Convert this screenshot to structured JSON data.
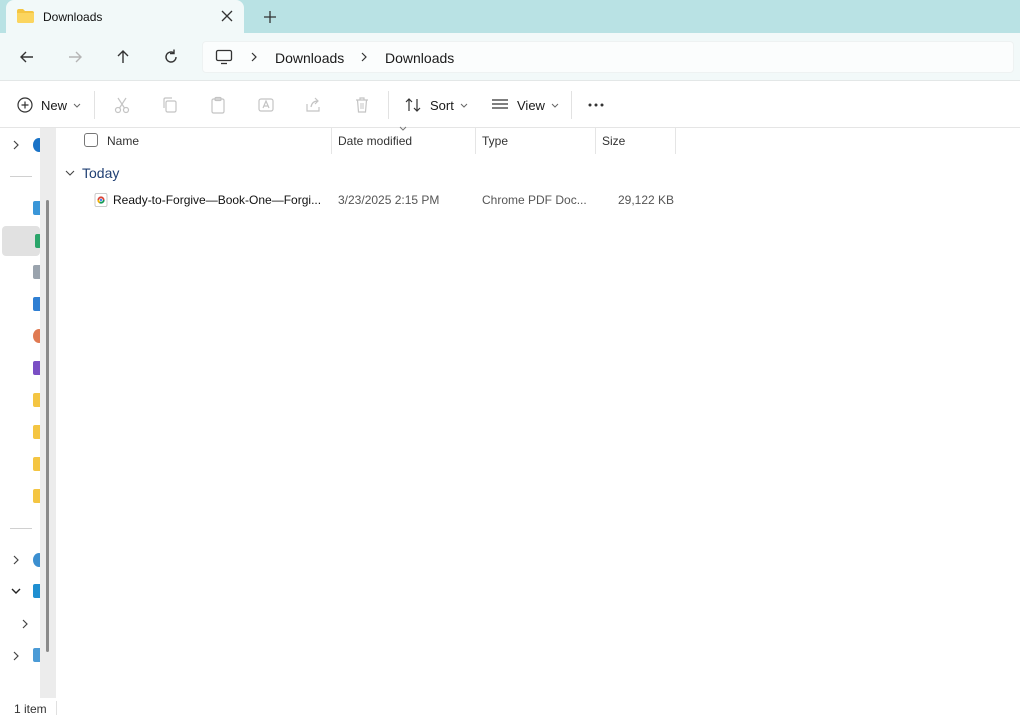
{
  "tab": {
    "title": "Downloads"
  },
  "address": {
    "crumbs": [
      "Downloads",
      "Downloads"
    ]
  },
  "toolbar": {
    "new_label": "New",
    "sort_label": "Sort",
    "view_label": "View"
  },
  "columns": {
    "name": "Name",
    "date": "Date modified",
    "type": "Type",
    "size": "Size"
  },
  "group": {
    "label": "Today"
  },
  "files": [
    {
      "name": "Ready-to-Forgive—Book-One—Forgi...",
      "date": "3/23/2025 2:15 PM",
      "type": "Chrome PDF Doc...",
      "size": "29,122 KB"
    }
  ],
  "status": {
    "item_count": "1 item"
  },
  "colors": {
    "tabbar": "#b9e2e4",
    "accent": "#1f3f73",
    "folder": "#f4c542"
  }
}
